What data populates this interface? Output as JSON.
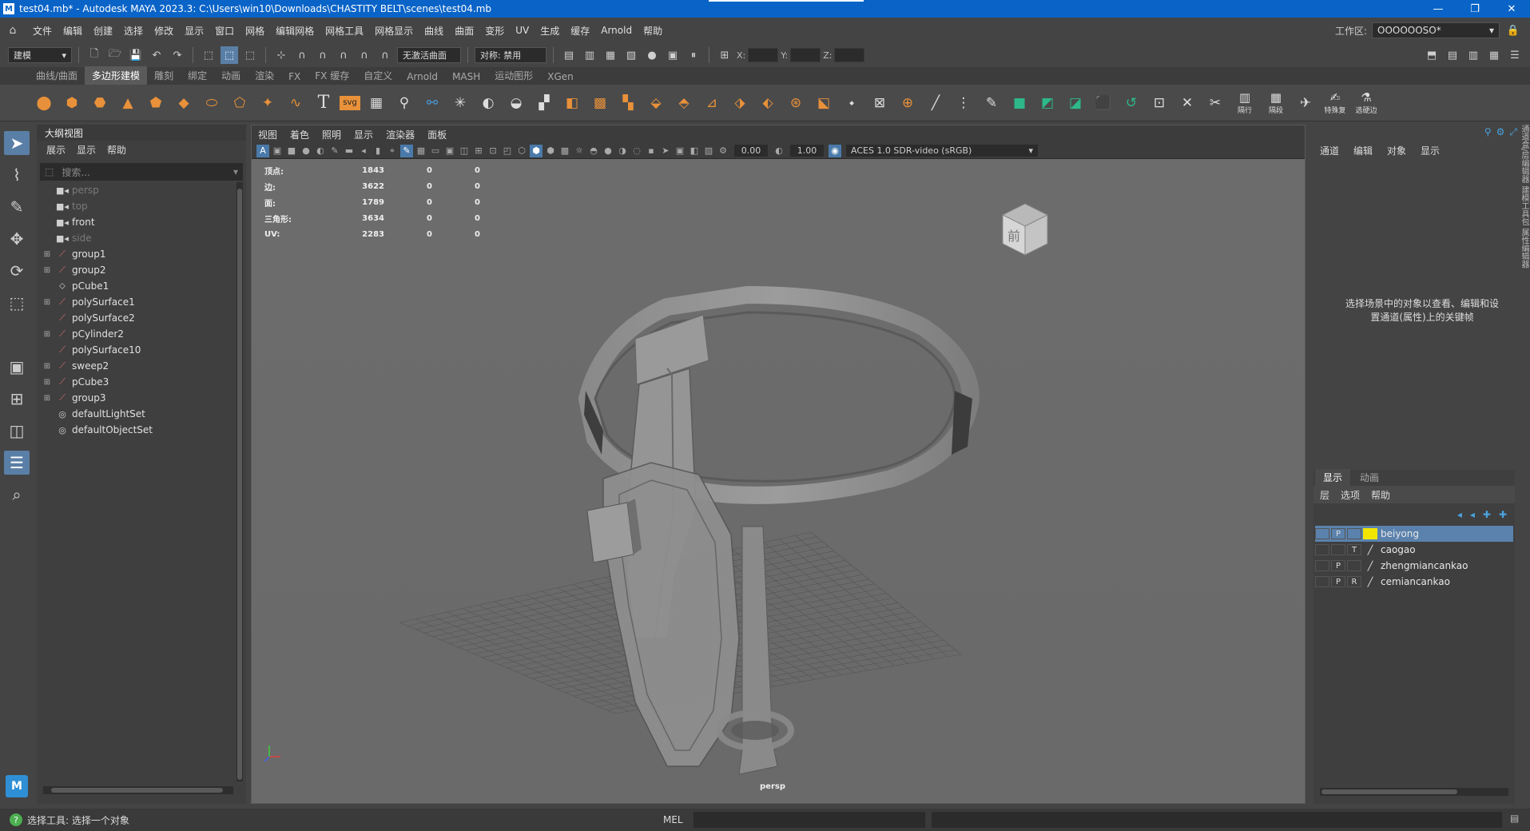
{
  "window": {
    "title": "test04.mb* - Autodesk MAYA 2023.3: C:\\Users\\win10\\Downloads\\CHASTITY BELT\\scenes\\test04.mb",
    "app_icon": "M",
    "controls": [
      "—",
      "❐",
      "✕"
    ]
  },
  "menubar": {
    "items": [
      "文件",
      "编辑",
      "创建",
      "选择",
      "修改",
      "显示",
      "窗口",
      "网格",
      "编辑网格",
      "网格工具",
      "网格显示",
      "曲线",
      "曲面",
      "变形",
      "UV",
      "生成",
      "缓存",
      "Arnold",
      "帮助"
    ],
    "workspace_label": "工作区:",
    "workspace_value": "OOOOOOSO*"
  },
  "statusline": {
    "mode": "建模",
    "live_surface": "无激活曲面",
    "symmetry": "对称: 禁用",
    "x_label": "X:",
    "y_label": "Y:",
    "z_label": "Z:"
  },
  "shelf": {
    "tabs": [
      "曲线/曲面",
      "多边形建模",
      "雕刻",
      "绑定",
      "动画",
      "渲染",
      "FX",
      "FX 缓存",
      "自定义",
      "Arnold",
      "MASH",
      "运动图形",
      "XGen"
    ],
    "active_tab": 1,
    "svg_label": "svg",
    "t_label": "T",
    "labeled": [
      {
        "label": "隔行"
      },
      {
        "label": "隔段"
      },
      {
        "label": "特殊复"
      },
      {
        "label": "选硬边"
      }
    ]
  },
  "outliner": {
    "title": "大纲视图",
    "menu": [
      "展示",
      "显示",
      "帮助"
    ],
    "search_placeholder": "搜索...",
    "items": [
      {
        "label": "persp",
        "icon": "■◂",
        "dim": true,
        "expand": ""
      },
      {
        "label": "top",
        "icon": "■◂",
        "dim": true,
        "expand": ""
      },
      {
        "label": "front",
        "icon": "■◂",
        "dim": false,
        "expand": ""
      },
      {
        "label": "side",
        "icon": "■◂",
        "dim": true,
        "expand": ""
      },
      {
        "label": "group1",
        "icon": "⟋",
        "dim": false,
        "expand": "⊞"
      },
      {
        "label": "group2",
        "icon": "⟋",
        "dim": false,
        "expand": "⊞"
      },
      {
        "label": "pCube1",
        "icon": "⬦",
        "dim": false,
        "expand": ""
      },
      {
        "label": "polySurface1",
        "icon": "⟋",
        "dim": false,
        "expand": "⊞"
      },
      {
        "label": "polySurface2",
        "icon": "⟋",
        "dim": false,
        "expand": ""
      },
      {
        "label": "pCylinder2",
        "icon": "⟋",
        "dim": false,
        "expand": "⊞"
      },
      {
        "label": "polySurface10",
        "icon": "⟋",
        "dim": false,
        "expand": ""
      },
      {
        "label": "sweep2",
        "icon": "⟋",
        "dim": false,
        "expand": "⊞"
      },
      {
        "label": "pCube3",
        "icon": "⟋",
        "dim": false,
        "expand": "⊞"
      },
      {
        "label": "group3",
        "icon": "⟋",
        "dim": false,
        "expand": "⊞"
      },
      {
        "label": "defaultLightSet",
        "icon": "◎",
        "dim": false,
        "expand": ""
      },
      {
        "label": "defaultObjectSet",
        "icon": "◎",
        "dim": false,
        "expand": ""
      }
    ]
  },
  "viewport": {
    "menu": [
      "视图",
      "着色",
      "照明",
      "显示",
      "渲染器",
      "面板"
    ],
    "exposure": "0.00",
    "gamma": "1.00",
    "colorspace": "ACES 1.0 SDR-video (sRGB)",
    "camera": "persp",
    "viewcube_label": "前",
    "stats": [
      {
        "label": "顶点:",
        "v1": "1843",
        "v2": "0",
        "v3": "0"
      },
      {
        "label": "边:",
        "v1": "3622",
        "v2": "0",
        "v3": "0"
      },
      {
        "label": "面:",
        "v1": "1789",
        "v2": "0",
        "v3": "0"
      },
      {
        "label": "三角形:",
        "v1": "3634",
        "v2": "0",
        "v3": "0"
      },
      {
        "label": "UV:",
        "v1": "2283",
        "v2": "0",
        "v3": "0"
      }
    ]
  },
  "channelbox": {
    "menu": [
      "通道",
      "编辑",
      "对象",
      "显示"
    ],
    "message_line1": "选择场景中的对象以查看、编辑和设",
    "message_line2": "置通道(属性)上的关键帧",
    "side_tabs": "通道盒/层编辑器 建模工具包 属性编辑器"
  },
  "layers": {
    "tabs": [
      "显示",
      "动画"
    ],
    "menu": [
      "层",
      "选项",
      "帮助"
    ],
    "rows": [
      {
        "name": "beiyong",
        "vis": "",
        "p": "P",
        "type": "",
        "color": "#f2e600",
        "selected": true
      },
      {
        "name": "caogao",
        "vis": "",
        "p": "",
        "type": "T",
        "color": "",
        "selected": false
      },
      {
        "name": "zhengmiancankao",
        "vis": "",
        "p": "P",
        "type": "",
        "color": "",
        "selected": false
      },
      {
        "name": "cemiancankao",
        "vis": "",
        "p": "P",
        "type": "R",
        "color": "",
        "selected": false
      }
    ]
  },
  "helpline": {
    "message": "选择工具: 选择一个对象",
    "mel_label": "MEL"
  }
}
